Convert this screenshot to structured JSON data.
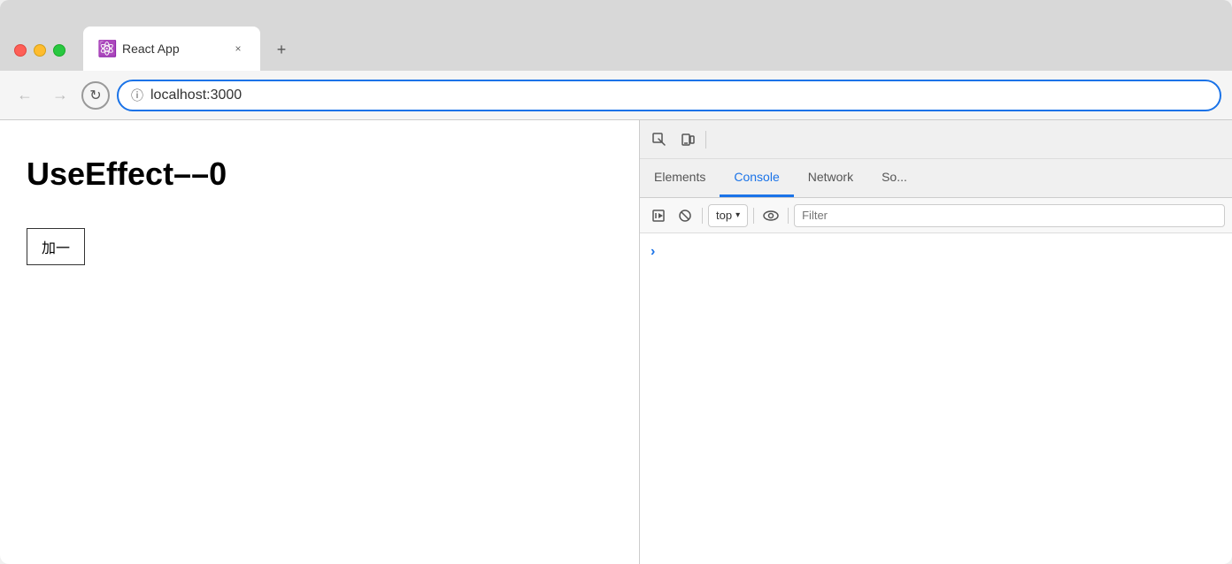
{
  "browser": {
    "tab": {
      "title": "React App",
      "favicon": "⚛",
      "close_label": "×"
    },
    "new_tab_label": "+",
    "nav": {
      "back_label": "←",
      "forward_label": "→",
      "reload_label": "↻",
      "address": "localhost:3000",
      "info_icon": "ⓘ"
    }
  },
  "page": {
    "heading": "UseEffect––0",
    "button_label": "加一"
  },
  "devtools": {
    "toolbar": {
      "inspect_icon": "cursor",
      "device_icon": "device",
      "separator": ""
    },
    "tabs": [
      {
        "id": "elements",
        "label": "Elements",
        "active": false
      },
      {
        "id": "console",
        "label": "Console",
        "active": true
      },
      {
        "id": "network",
        "label": "Network",
        "active": false
      },
      {
        "id": "sources",
        "label": "So...",
        "active": false
      }
    ],
    "console": {
      "toolbar": {
        "play_icon": "▶",
        "block_icon": "🚫",
        "top_label": "top",
        "dropdown_icon": "▾",
        "eye_icon": "👁",
        "filter_placeholder": "Filter"
      },
      "chevron": "›"
    }
  },
  "colors": {
    "active_tab_blue": "#1a73e8",
    "address_border": "#1a73e8",
    "traffic_red": "#fe5f57",
    "traffic_yellow": "#febc2e",
    "traffic_green": "#28c840"
  }
}
